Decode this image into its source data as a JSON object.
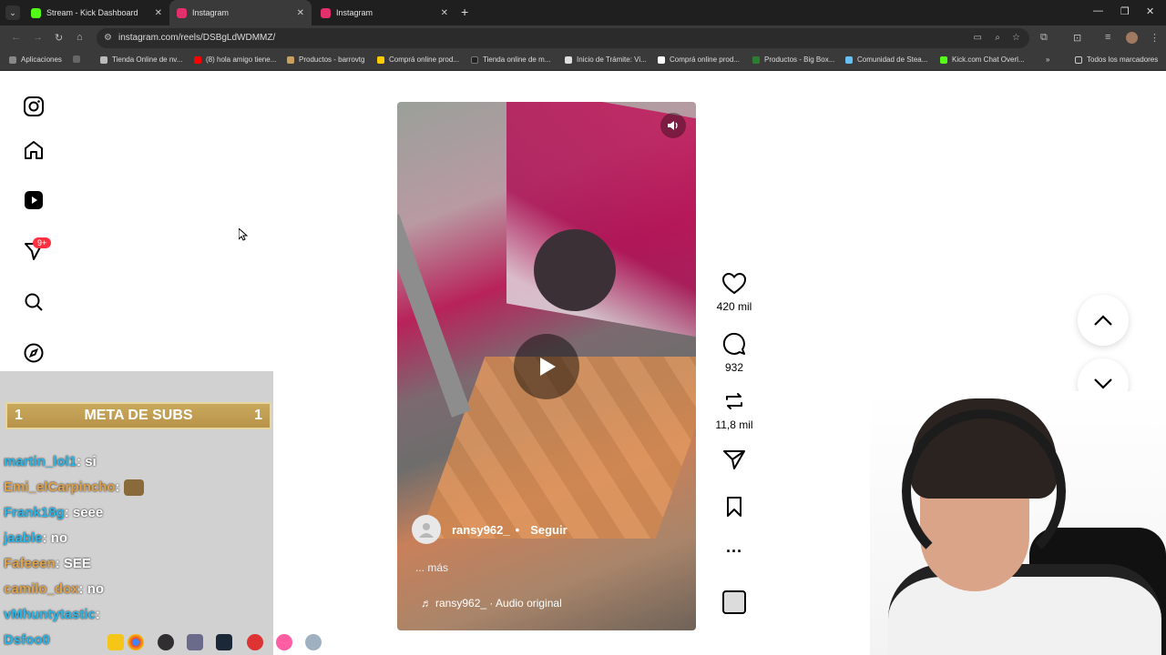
{
  "browser": {
    "tabs": [
      {
        "label": "Stream - Kick Dashboard",
        "color": "#53fc18"
      },
      {
        "label": "Instagram",
        "color": "#e1306c"
      },
      {
        "label": "Instagram",
        "color": "#e1306c"
      }
    ],
    "url": "instagram.com/reels/DSBgLdWDMMZ/",
    "bookmarks": [
      {
        "label": "Aplicaciones",
        "color": "#888888"
      },
      {
        "label": "Tienda Online de nv...",
        "color": "#bbbbbb"
      },
      {
        "label": "(8) hola amigo tiene...",
        "color": "#ff0000"
      },
      {
        "label": "Productos - barrovtg",
        "color": "#c8a060"
      },
      {
        "label": "Comprá online prod...",
        "color": "#ffcc00"
      },
      {
        "label": "Tienda online de m...",
        "color": "#222222"
      },
      {
        "label": "Inicio de Trámite: Vi...",
        "color": "#dddddd"
      },
      {
        "label": "Comprá online prod...",
        "color": "#ffffff"
      },
      {
        "label": "Productos - Big Box...",
        "color": "#2e7d32"
      },
      {
        "label": "Comunidad de Stea...",
        "color": "#66c0f4"
      },
      {
        "label": "Kick.com Chat Overl...",
        "color": "#53fc18"
      }
    ],
    "all_bookmarks": "Todos los marcadores",
    "more_bookmarks": "»"
  },
  "sidebar": {
    "badge": "9+"
  },
  "reel": {
    "username": "ransy962_",
    "separator": "•",
    "follow_label": "Seguir",
    "more_label": "... más",
    "audio_label": "ransy962_ · Audio original"
  },
  "actions": {
    "likes": "420 mil",
    "comments": "932",
    "reposts": "11,8 mil"
  },
  "overlay": {
    "meta_title": "META DE SUBS",
    "meta_left": "1",
    "meta_right": "1",
    "chat": [
      {
        "user": "martin_lol1",
        "msg": ": si"
      },
      {
        "user": "Emi_elCarpincho",
        "msg": ":"
      },
      {
        "user": "Frank18g",
        "msg": ": seee"
      },
      {
        "user": "jaable",
        "msg": ": no"
      },
      {
        "user": "Fafeeen",
        "msg": ": SEE"
      },
      {
        "user": "camilo_dox",
        "msg": ": no"
      },
      {
        "user": "vMhuntytastic",
        "msg": ":"
      },
      {
        "user": "Dsfoo0",
        "msg": ""
      }
    ]
  }
}
